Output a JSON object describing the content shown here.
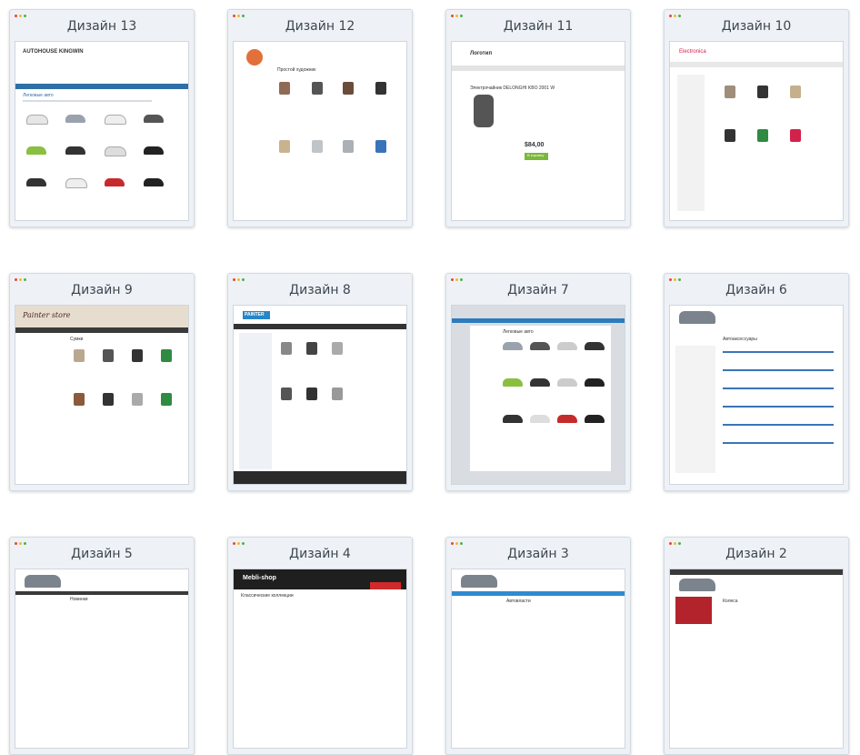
{
  "cards": [
    {
      "title": "Дизайн 13"
    },
    {
      "title": "Дизайн 12"
    },
    {
      "title": "Дизайн 11"
    },
    {
      "title": "Дизайн 10"
    },
    {
      "title": "Дизайн 9"
    },
    {
      "title": "Дизайн 8"
    },
    {
      "title": "Дизайн 7"
    },
    {
      "title": "Дизайн 6"
    },
    {
      "title": "Дизайн 5"
    },
    {
      "title": "Дизайн 4"
    },
    {
      "title": "Дизайн 3"
    },
    {
      "title": "Дизайн 2"
    }
  ],
  "thumbs": {
    "t13": {
      "brand": "AUTOHOUSE KINGWIN",
      "heading": "Легковые авто"
    },
    "t12": {
      "heading": "Простой художник"
    },
    "t11": {
      "brand": "Логотип",
      "heading": "Электрочайник DELONGHI KBO 2001 W",
      "price": "$84,00",
      "cart": "В корзину"
    },
    "t10": {
      "brand": "Electronica"
    },
    "t9": {
      "brand": "Painter store",
      "heading": "Сумки"
    },
    "t8": {
      "brand": "PAINTER"
    },
    "t7": {
      "heading": "Легковые авто"
    },
    "t6": {
      "heading": "Автоаксессуары"
    },
    "t5": {
      "heading": "Новинки"
    },
    "t4": {
      "brand": "Mebli-shop",
      "heading": "Классические коллекции"
    },
    "t3": {
      "heading": "Автовласти"
    },
    "t2": {
      "heading": "Колеса"
    }
  }
}
